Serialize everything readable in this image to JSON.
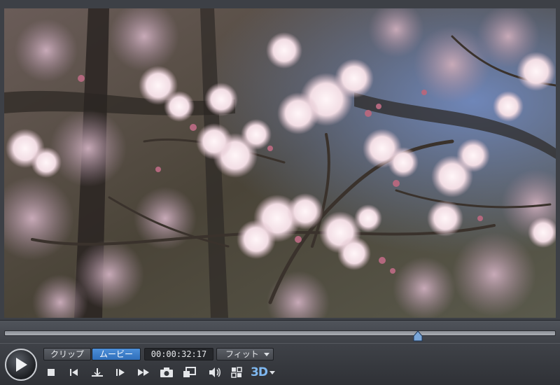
{
  "player": {
    "mode_tabs": [
      {
        "label": "クリップ",
        "selected": false
      },
      {
        "label": "ムービー",
        "selected": true
      }
    ],
    "timecode": "00:00:32:17",
    "zoom_select": {
      "value": "フィット"
    },
    "stereo_label": "3D",
    "playback_progress": 0.75
  },
  "icons": {
    "play": "play-icon",
    "stop": "stop-icon",
    "prev_frame": "previous-frame-icon",
    "mark": "mark-in-icon",
    "next_frame": "next-frame-icon",
    "fast_forward": "fast-forward-icon",
    "snapshot": "camera-icon",
    "display": "display-switch-icon",
    "volume": "volume-icon",
    "settings": "settings-grid-icon"
  },
  "colors": {
    "accent": "#3a7fd0",
    "stereo": "#7fb8f0"
  }
}
